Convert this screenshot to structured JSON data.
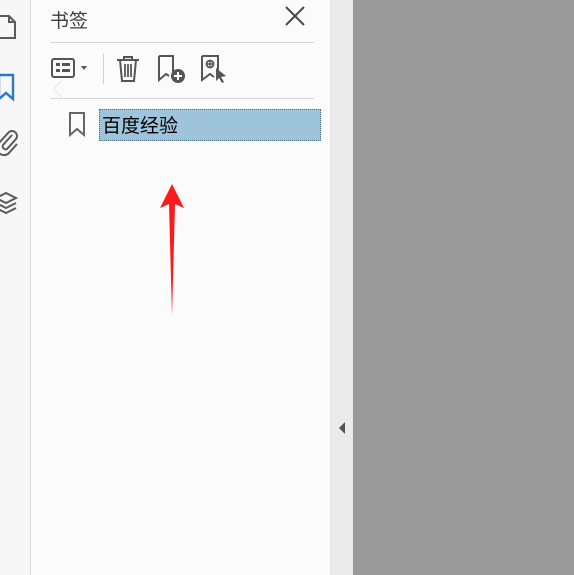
{
  "panel": {
    "title": "书签"
  },
  "bookmarks": [
    {
      "label": "百度经验"
    }
  ],
  "icons": {
    "rail": [
      "page-thumbnails-icon",
      "bookmark-icon",
      "attachment-icon",
      "layers-icon"
    ],
    "toolbar": [
      "options-menu-icon",
      "delete-icon",
      "new-bookmark-icon",
      "bookmark-from-selection-icon"
    ]
  },
  "colors": {
    "accent": "#2a78c8",
    "selection": "#9ec4dc",
    "arrow": "#ff1a1a",
    "doc_background": "#9a9a9a"
  }
}
